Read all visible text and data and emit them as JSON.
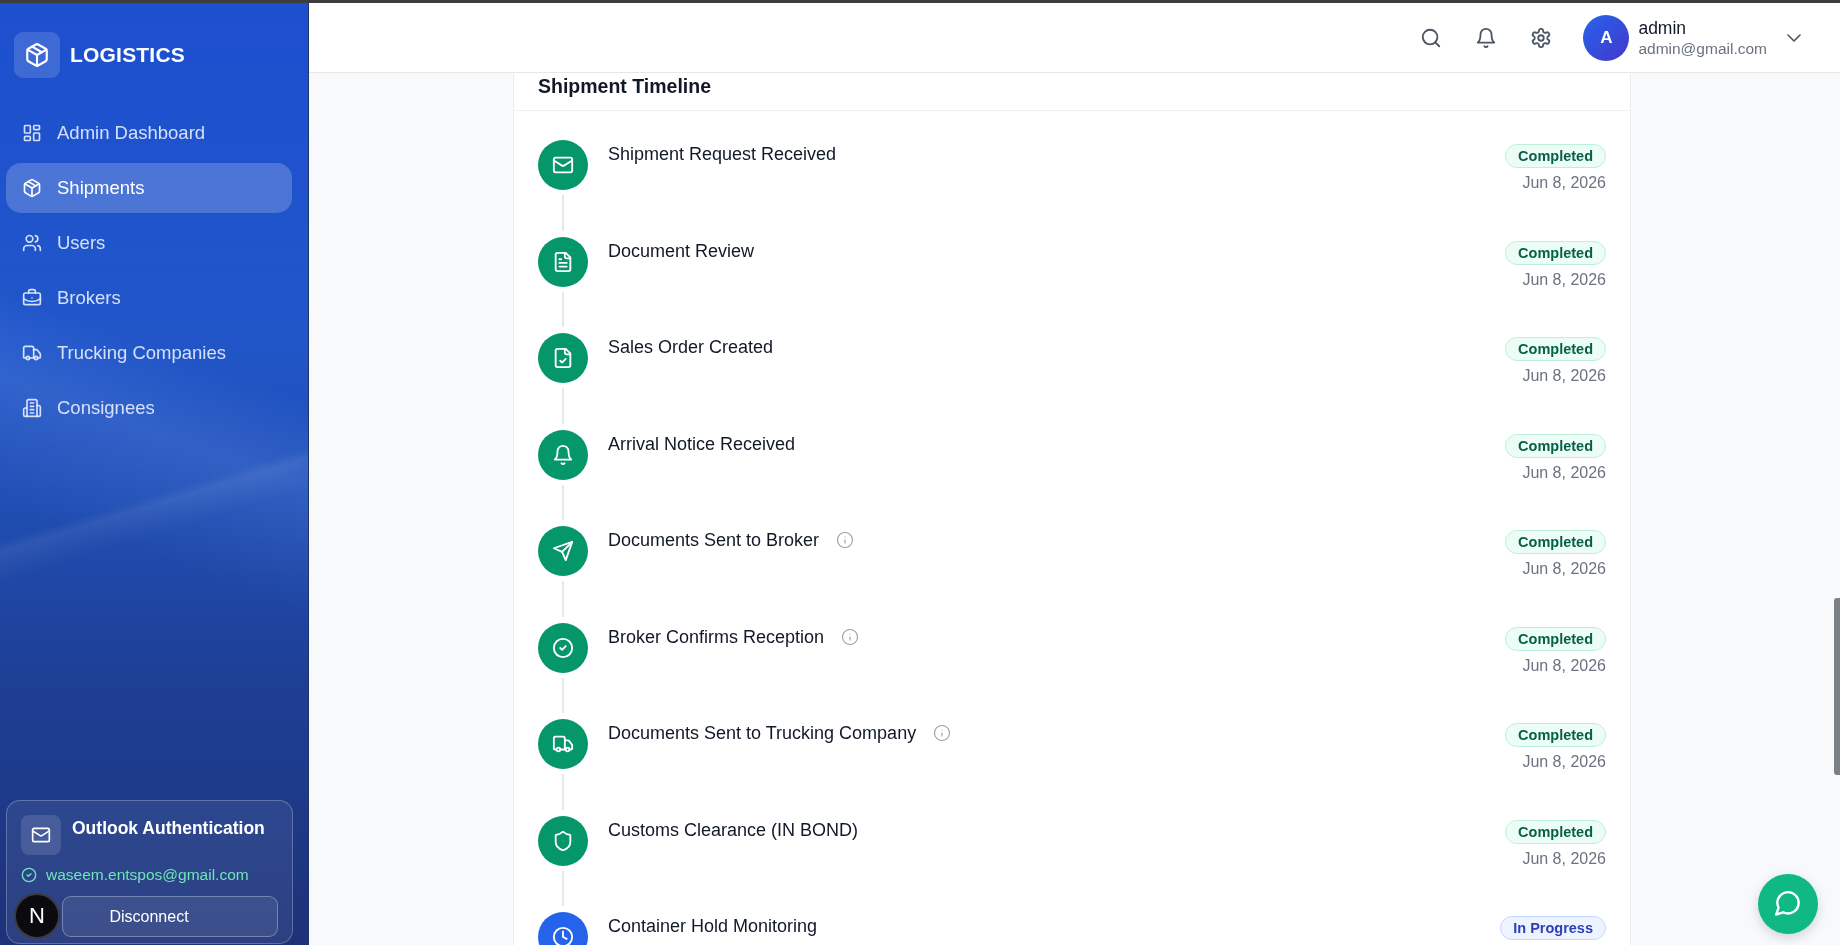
{
  "sidebar": {
    "brand": "LOGISTICS",
    "nav_items": [
      {
        "label": "Admin Dashboard",
        "selected": false
      },
      {
        "label": "Shipments",
        "selected": true
      },
      {
        "label": "Users",
        "selected": false
      },
      {
        "label": "Brokers",
        "selected": false
      },
      {
        "label": "Trucking Companies",
        "selected": false
      },
      {
        "label": "Consignees",
        "selected": false
      }
    ],
    "outlook_card": {
      "title": "Outlook Authentication",
      "connected": true,
      "email": "waseem.entspos@gmail.com",
      "button": "Disconnect"
    }
  },
  "dev_badge": {
    "label": "N"
  },
  "top_bar": {
    "user": {
      "avatar_initial": "A",
      "name": "admin",
      "email": "admin@gmail.com"
    }
  },
  "timeline": {
    "title": "Shipment Timeline",
    "steps": [
      {
        "title": "Shipment Request Received",
        "info": false,
        "kind": "completed",
        "status": "Completed",
        "date": "Jun 8, 2026"
      },
      {
        "title": "Document Review",
        "info": false,
        "kind": "completed",
        "status": "Completed",
        "date": "Jun 8, 2026"
      },
      {
        "title": "Sales Order Created",
        "info": false,
        "kind": "completed",
        "status": "Completed",
        "date": "Jun 8, 2026"
      },
      {
        "title": "Arrival Notice Received",
        "info": false,
        "kind": "completed",
        "status": "Completed",
        "date": "Jun 8, 2026"
      },
      {
        "title": "Documents Sent to Broker",
        "info": true,
        "kind": "completed",
        "status": "Completed",
        "date": "Jun 8, 2026"
      },
      {
        "title": "Broker Confirms Reception",
        "info": true,
        "kind": "completed",
        "status": "Completed",
        "date": "Jun 8, 2026"
      },
      {
        "title": "Documents Sent to Trucking Company",
        "info": true,
        "kind": "completed",
        "status": "Completed",
        "date": "Jun 8, 2026"
      },
      {
        "title": "Customs Clearance (IN BOND)",
        "info": false,
        "kind": "completed",
        "status": "Completed",
        "date": "Jun 8, 2026"
      },
      {
        "title": "Container Hold Monitoring",
        "info": false,
        "kind": "in_progress",
        "status": "In Progress"
      }
    ]
  }
}
